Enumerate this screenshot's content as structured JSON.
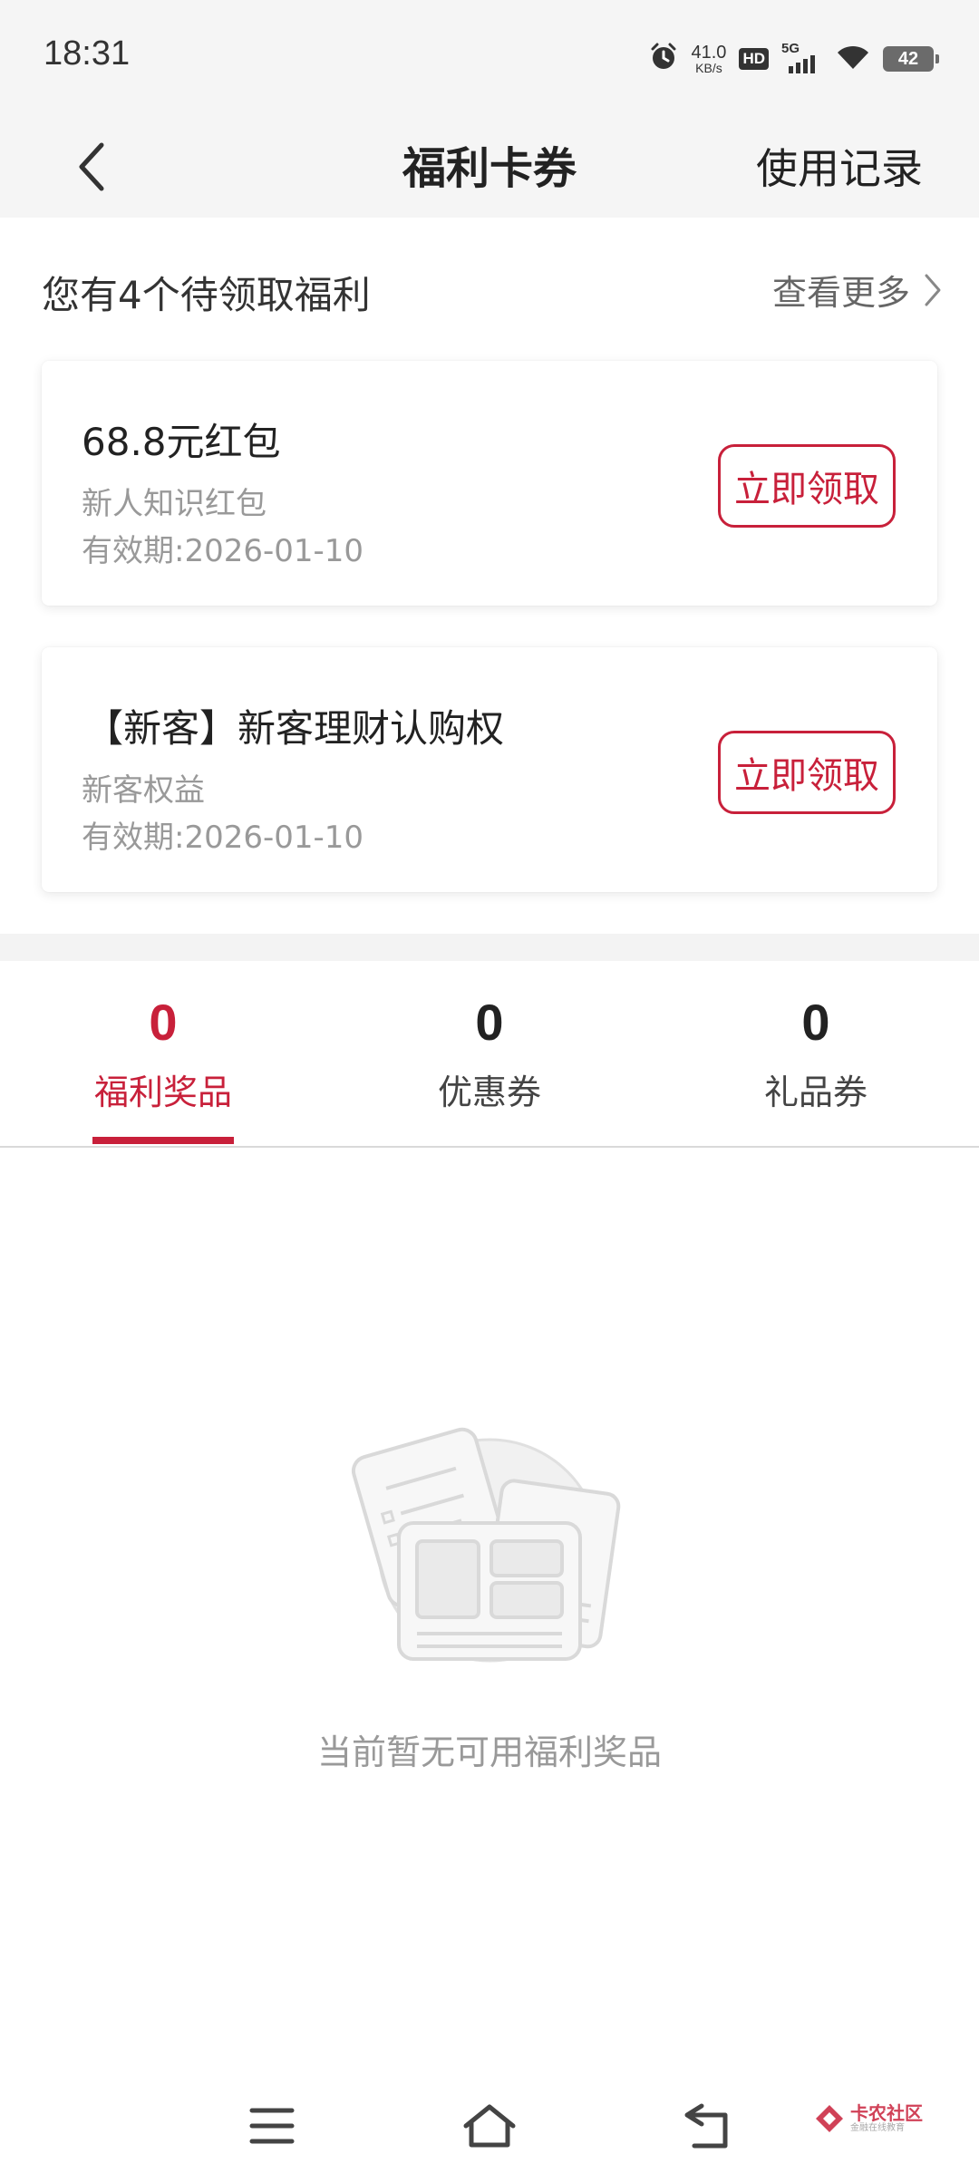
{
  "status_bar": {
    "time": "18:31",
    "net_speed_value": "41.0",
    "net_speed_unit": "KB/s",
    "hd_label": "HD",
    "network_label": "5G",
    "battery": "42"
  },
  "nav": {
    "title": "福利卡券",
    "record_label": "使用记录"
  },
  "pending": {
    "title": "您有4个待领取福利",
    "see_more_label": "查看更多"
  },
  "cards": [
    {
      "title": "68.8元红包",
      "subtitle": "新人知识红包",
      "expiry": "有效期:2026-01-10",
      "button_label": "立即领取"
    },
    {
      "title": "【新客】新客理财认购权",
      "subtitle": "新客权益",
      "expiry": "有效期:2026-01-10",
      "button_label": "立即领取"
    }
  ],
  "tabs": [
    {
      "count": "0",
      "label": "福利奖品",
      "active": true
    },
    {
      "count": "0",
      "label": "优惠券",
      "active": false
    },
    {
      "count": "0",
      "label": "礼品券",
      "active": false
    }
  ],
  "empty_state": {
    "text": "当前暂无可用福利奖品"
  },
  "watermark": {
    "name": "卡农社区",
    "tagline": "金融在线教育"
  },
  "colors": {
    "accent": "#c8203a",
    "header_bg": "#f5f5f5",
    "muted_text": "#999999"
  }
}
